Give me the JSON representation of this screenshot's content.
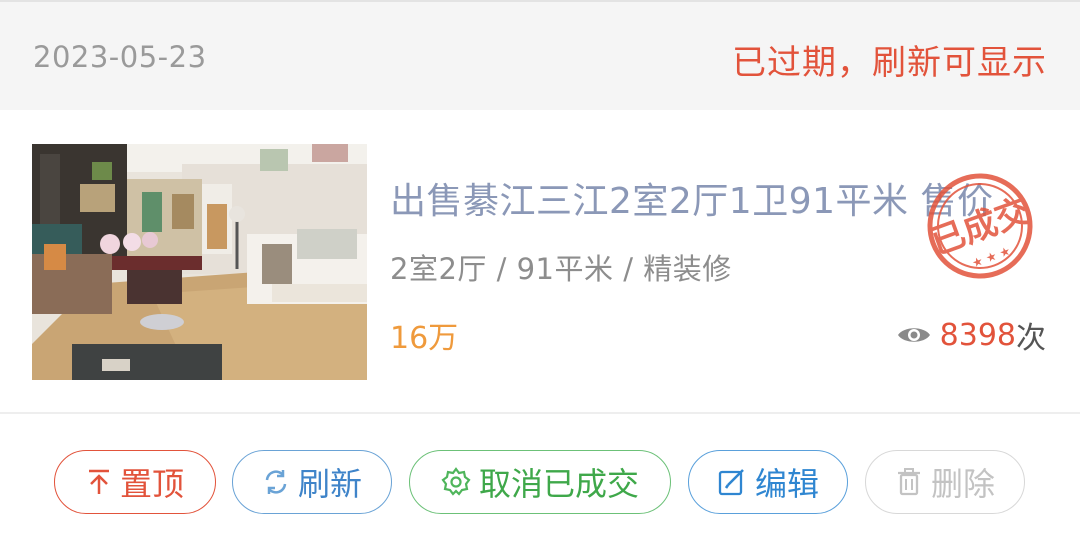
{
  "header": {
    "date": "2023-05-23",
    "status_text": "已过期，刷新可显示"
  },
  "listing": {
    "title": "出售綦江三江2室2厅1卫91平米 售价",
    "specs": "2室2厅 / 91平米 / 精装修",
    "price": "16万",
    "view_count": "8398",
    "view_unit": "次",
    "stamp_text": "已成交"
  },
  "actions": {
    "top": "置顶",
    "refresh": "刷新",
    "cancel_deal": "取消已成交",
    "edit": "编辑",
    "delete": "删除"
  },
  "colors": {
    "accent_red": "#e2533b",
    "price_orange": "#ef9a3c",
    "title_gray_blue": "#8b98b7",
    "refresh_blue": "#3f84c9",
    "cancel_green": "#3fa84a",
    "disabled_gray": "#c3c3c3"
  },
  "icons": [
    "arrow-up-icon",
    "refresh-icon",
    "gear-icon",
    "edit-icon",
    "trash-icon",
    "eye-icon"
  ]
}
